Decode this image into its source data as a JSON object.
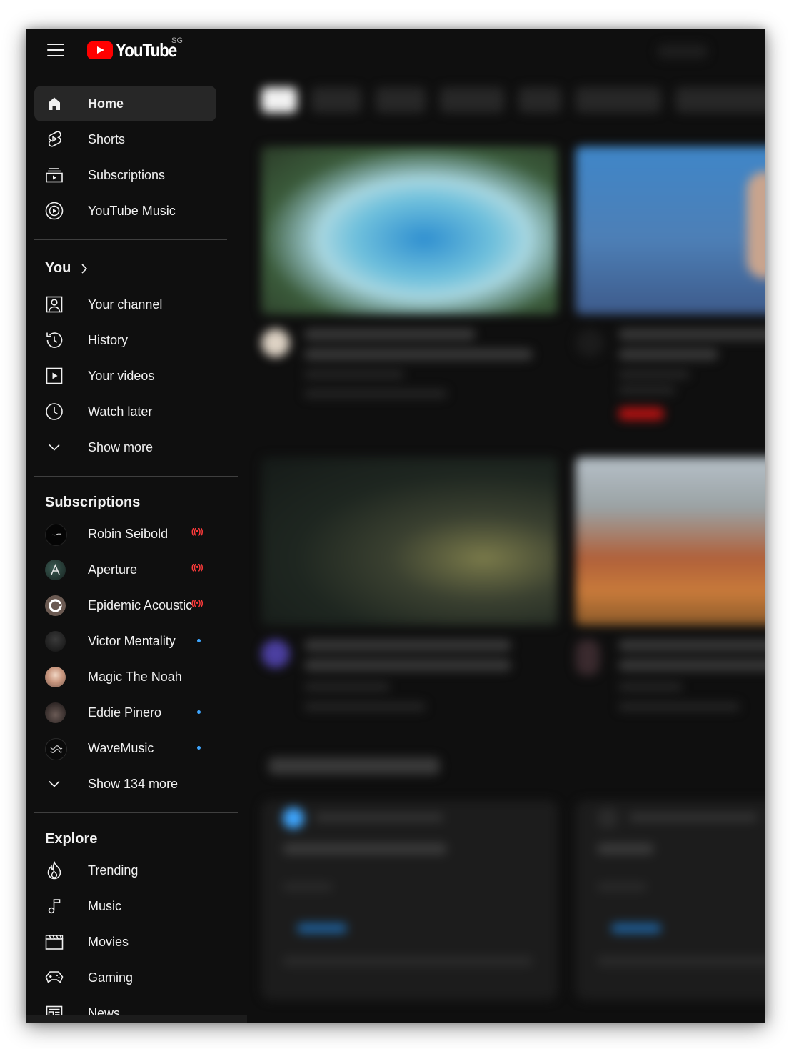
{
  "masthead": {
    "logo_text": "YouTube",
    "region": "SG"
  },
  "nav": {
    "main": [
      {
        "label": "Home",
        "icon": "home-icon",
        "active": true
      },
      {
        "label": "Shorts",
        "icon": "shorts-icon"
      },
      {
        "label": "Subscriptions",
        "icon": "subscriptions-icon"
      },
      {
        "label": "YouTube Music",
        "icon": "youtube-music-icon"
      }
    ],
    "you": {
      "heading": "You",
      "items": [
        {
          "label": "Your channel",
          "icon": "your-channel-icon"
        },
        {
          "label": "History",
          "icon": "history-icon"
        },
        {
          "label": "Your videos",
          "icon": "your-videos-icon"
        },
        {
          "label": "Watch later",
          "icon": "watch-later-icon"
        },
        {
          "label": "Show more",
          "icon": "chevron-down-icon"
        }
      ]
    },
    "subscriptions": {
      "heading": "Subscriptions",
      "channels": [
        {
          "name": "Robin Seibold",
          "status": "live",
          "live_symbol": "((•))"
        },
        {
          "name": "Aperture",
          "status": "live",
          "live_symbol": "((•))"
        },
        {
          "name": "Epidemic Acoustic",
          "status": "live",
          "live_symbol": "((•))"
        },
        {
          "name": "Victor Mentality",
          "status": "new"
        },
        {
          "name": "Magic The Noah",
          "status": "none"
        },
        {
          "name": "Eddie Pinero",
          "status": "new"
        },
        {
          "name": "WaveMusic",
          "status": "new"
        }
      ],
      "show_more": "Show 134 more"
    },
    "explore": {
      "heading": "Explore",
      "items": [
        {
          "label": "Trending",
          "icon": "trending-icon"
        },
        {
          "label": "Music",
          "icon": "music-icon"
        },
        {
          "label": "Movies",
          "icon": "movies-icon"
        },
        {
          "label": "Gaming",
          "icon": "gaming-icon"
        },
        {
          "label": "News",
          "icon": "news-icon"
        }
      ]
    }
  },
  "colors": {
    "background": "#0f0f0f",
    "active_item": "#272727",
    "brand_red": "#ff0000",
    "live_red": "#ff3b3b",
    "new_dot": "#3ea6ff",
    "text": "#f1f1f1"
  }
}
